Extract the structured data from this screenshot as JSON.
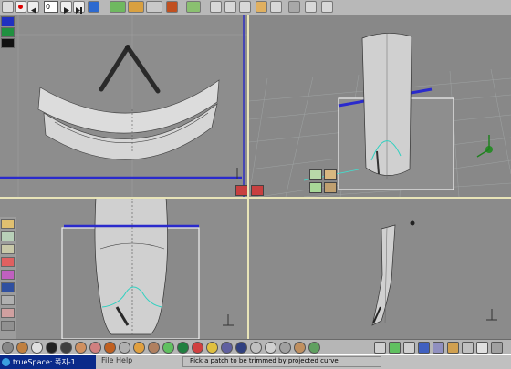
{
  "toolbar": {
    "frame_value": "0",
    "icons": [
      "record-icon",
      "stop-icon",
      "rewind-icon",
      "play-icon",
      "forward-icon",
      "end-icon",
      "object-tool-icon",
      "move-icon",
      "rotate-icon",
      "scale-icon",
      "deform-icon",
      "tools-icon",
      "render-icon",
      "point-edit-icon",
      "undo-icon",
      "redo-icon",
      "delete-icon"
    ]
  },
  "viewports": {
    "top": {
      "name": "top-view"
    },
    "perspective": {
      "name": "perspective-view"
    },
    "front": {
      "name": "front-view"
    },
    "right": {
      "name": "right-view"
    }
  },
  "statusbar": {
    "app_title": "trueSpace: 쪽지-1",
    "menu_file": "File",
    "menu_help": "Help",
    "status_text": "Pick a patch to be trimmed by projected curve"
  },
  "colors": {
    "accent_blue": "#2a2acc",
    "selection_cyan": "#40e0d0",
    "title_bar": "#0a2a8a",
    "viewport_bg": "#8d8d8d",
    "splitter": "#e8e4b8"
  }
}
